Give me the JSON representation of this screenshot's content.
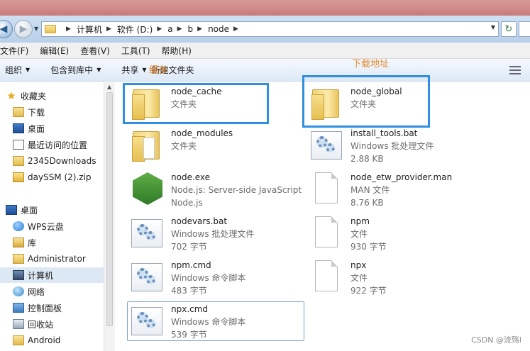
{
  "window": {
    "address": [
      "计算机",
      "软件 (D:)",
      "a",
      "b",
      "node"
    ]
  },
  "menu": [
    "文件(F)",
    "编辑(E)",
    "查看(V)",
    "工具(T)",
    "帮助(H)"
  ],
  "toolbar": {
    "organize": "组织",
    "include_library": "包含到库中",
    "share": "共享",
    "new_folder": "新建文件夹"
  },
  "annotations": {
    "cache": "缓存",
    "global": "下载地址",
    "color": "#e8852b",
    "highlight_color": "#2f8fe0"
  },
  "sidebar": {
    "favorites": "收藏夹",
    "items": [
      "下载",
      "桌面",
      "最近访问的位置",
      "2345Downloads",
      "daySSM (2).zip"
    ],
    "desktop": "桌面",
    "tree": [
      "WPS云盘",
      "库",
      "Administrator",
      "计算机",
      "网络",
      "控制面板",
      "回收站",
      "Android"
    ]
  },
  "files": [
    {
      "name": "node_cache",
      "type": "文件夹",
      "size": "",
      "icon": "folder-icon"
    },
    {
      "name": "node_global",
      "type": "文件夹",
      "size": "",
      "icon": "folder-icon"
    },
    {
      "name": "node_modules",
      "type": "文件夹",
      "size": "",
      "icon": "folder-icon"
    },
    {
      "name": "install_tools.bat",
      "type": "Windows 批处理文件",
      "size": "2.88 KB",
      "icon": "batch-file-icon"
    },
    {
      "name": "node.exe",
      "type": "Node.js: Server-side JavaScript",
      "size": "Node.js",
      "icon": "nodejs-icon"
    },
    {
      "name": "node_etw_provider.man",
      "type": "MAN 文件",
      "size": "8.76 KB",
      "icon": "blank-file-icon"
    },
    {
      "name": "nodevars.bat",
      "type": "Windows 批处理文件",
      "size": "702 字节",
      "icon": "batch-file-icon"
    },
    {
      "name": "npm",
      "type": "文件",
      "size": "930 字节",
      "icon": "blank-file-icon"
    },
    {
      "name": "npm.cmd",
      "type": "Windows 命令脚本",
      "size": "483 字节",
      "icon": "batch-file-icon"
    },
    {
      "name": "npx",
      "type": "文件",
      "size": "922 字节",
      "icon": "blank-file-icon"
    },
    {
      "name": "npx.cmd",
      "type": "Windows 命令脚本",
      "size": "539 字节",
      "icon": "batch-file-icon"
    }
  ],
  "watermark": "CSDN @流殇l"
}
